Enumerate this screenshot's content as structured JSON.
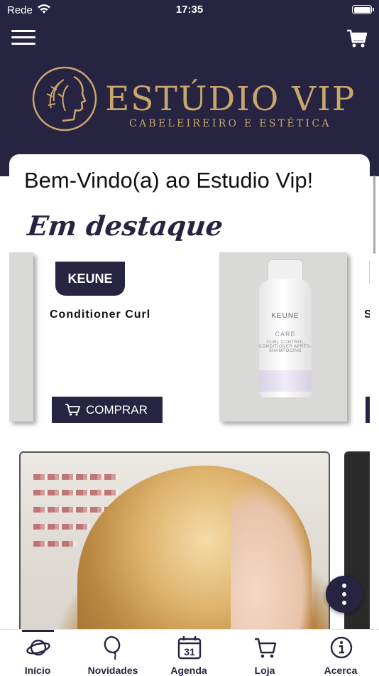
{
  "status_bar": {
    "carrier": "Rede",
    "time": "17:35"
  },
  "header": {
    "brand_name": "ESTÚDIO VIP",
    "brand_tagline": "CABELEIREIRO E ESTÉTICA",
    "menu_icon": "hamburger-menu-icon",
    "cart_icon": "shopping-cart-icon"
  },
  "main": {
    "welcome": "Bem-Vindo(a) ao Estudio Vip!",
    "section_title": "Em destaque",
    "product": {
      "brand": "KEUNE",
      "name": "Conditioner Curl",
      "buy_label": "COMPRAR",
      "bottle_brand": "KEUNE",
      "bottle_line": "CARE",
      "bottle_sub": "CURL CONTROL CONDITIONER APRÈS-SHAMPOOING"
    },
    "next_product_initial": "S"
  },
  "tabs": [
    {
      "label": "Início",
      "icon": "planet-icon",
      "active": true
    },
    {
      "label": "Novidades",
      "icon": "balloon-icon",
      "active": false
    },
    {
      "label": "Agenda",
      "icon": "calendar-icon",
      "active": false,
      "icon_text": "31"
    },
    {
      "label": "Loja",
      "icon": "cart-icon",
      "active": false
    },
    {
      "label": "Acerca",
      "icon": "info-icon",
      "active": false
    }
  ],
  "colors": {
    "primary": "#272442",
    "gold": "#c9a66b",
    "background": "#ffffff"
  }
}
